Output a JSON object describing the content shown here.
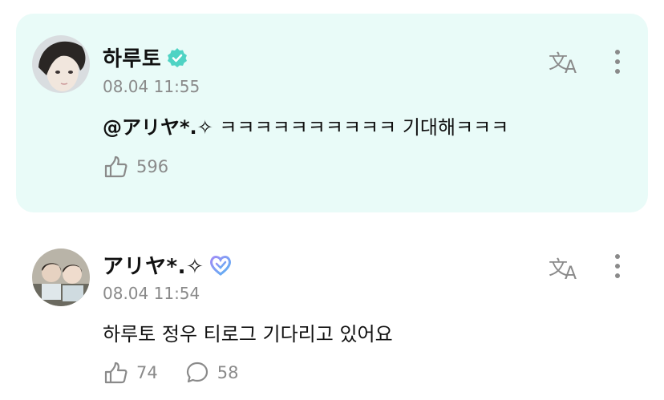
{
  "comments": [
    {
      "author": "하루토",
      "verified": true,
      "timestamp": "08.04 11:55",
      "mention": "@アリヤ*.✧",
      "text": " ㅋㅋㅋㅋㅋㅋㅋㅋㅋㅋ 기대해ㅋㅋㅋ",
      "likes": "596",
      "highlighted": true,
      "avatar_icon": "artist-avatar"
    },
    {
      "author": "アリヤ*.✧",
      "verified": false,
      "badge": "membership-heart-icon",
      "timestamp": "08.04 11:54",
      "text": "하루토 정우 티로그 기다리고 있어요",
      "likes": "74",
      "replies": "58",
      "highlighted": false,
      "avatar_icon": "user-avatar"
    }
  ],
  "colors": {
    "highlight_bg": "#e9fbf8",
    "verified": "#4fd3c4",
    "muted": "#8a8a8a"
  }
}
